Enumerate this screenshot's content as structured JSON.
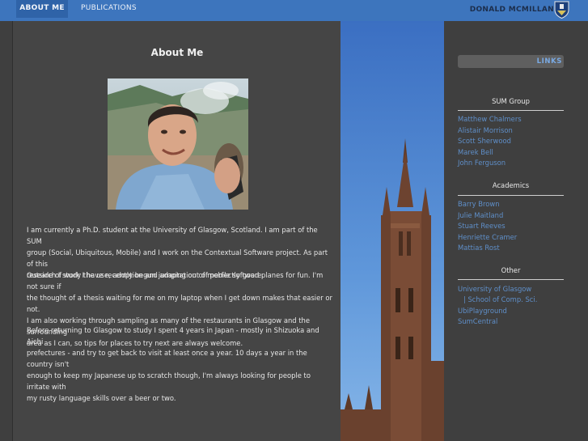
{
  "nav": {
    "about": "ABOUT ME",
    "publications": "PUBLICATIONS",
    "owner": "DONALD MCMILLAN"
  },
  "main": {
    "title": "About Me",
    "paragraphs": [
      [
        "I am currently a Ph.D. student at the University of Glasgow, Scotland. I am part of the SUM",
        "group (Social, Ubiquitous, Mobile) and I work on the Contextual Software project. As part of this",
        "research I study the use, adoption and adaptation of mobile software."
      ],
      [
        "Outside of work I have recently begun jumping out of perfectly good planes for fun. I'm not sure if",
        "the thought of a thesis waiting for me on my laptop when I get down makes that easier or not.",
        "I am also working through sampling as many of the restaurants in Glasgow and the surrounding",
        "area as I can, so tips for places to try next are always welcome."
      ],
      [
        "Before returning to Glasgow to study I spent 4 years in Japan - mostly in Shizuoka and Aichi",
        "prefectures - and try to get back to visit at least once a year. 10 days a year in the country isn't",
        "enough to keep my Japanese up to scratch though, I'm always looking for people to irritate with",
        "my rusty language skills over a beer or two."
      ]
    ]
  },
  "sidebar": {
    "links_label": "LINKS",
    "sections": [
      {
        "title": "SUM Group",
        "items": [
          "Matthew Chalmers",
          "Alistair Morrison",
          "Scott Sherwood",
          "Marek Bell",
          "John Ferguson"
        ]
      },
      {
        "title": "Academics",
        "items": [
          "Barry Brown",
          "Julie Maitland",
          "Stuart Reeves",
          "Henriette Cramer",
          "Mattias Rost"
        ]
      },
      {
        "title": "Other",
        "items": [
          "University of Glasgow",
          "| School of Comp. Sci.",
          "UbiPlayground",
          "SumCentral"
        ]
      }
    ]
  },
  "colors": {
    "nav_bar": "#3d75bd",
    "active_tab": "#2f63a8",
    "link": "#5f8fc9",
    "panel": "#454545",
    "page_bg": "#3f3f3f"
  }
}
